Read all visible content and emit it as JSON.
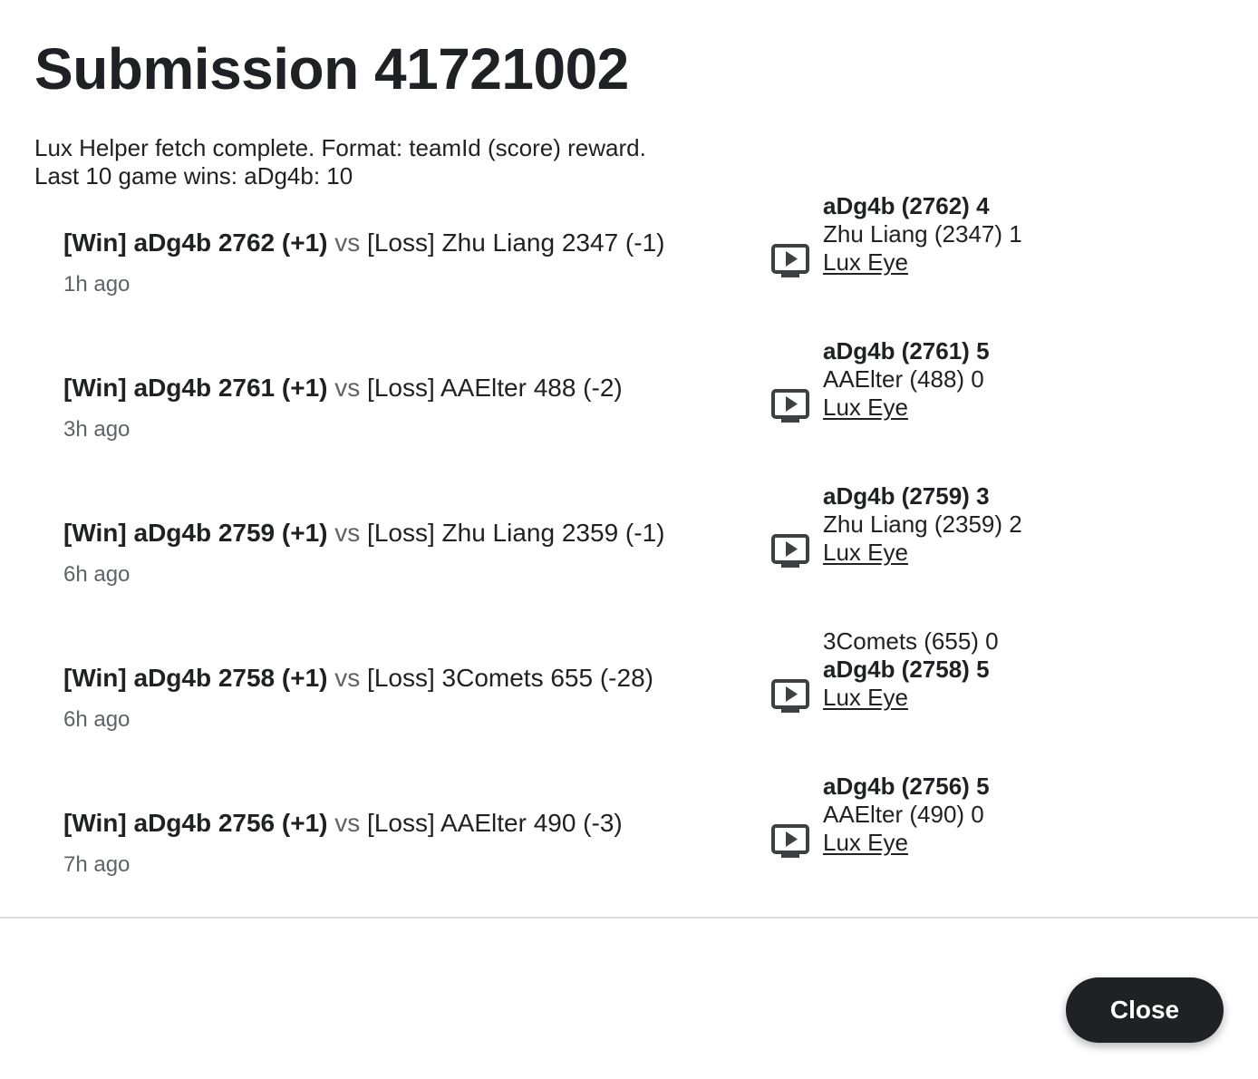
{
  "dialog": {
    "title": "Submission 41721002",
    "info_line1": "Lux Helper fetch complete. Format: teamId (score) reward.",
    "info_line2": "Last 10 game wins: aDg4b: 10",
    "close_label": "Close"
  },
  "matches": [
    {
      "win_text": "[Win] aDg4b 2762 (+1)",
      "vs": "vs",
      "loss_text": "[Loss] Zhu Liang 2347 (-1)",
      "time_ago": "1h ago",
      "team1": {
        "text": "aDg4b (2762) 4",
        "bold": true
      },
      "team2": {
        "text": "Zhu Liang (2347) 1",
        "bold": false
      },
      "link_label": "Lux Eye"
    },
    {
      "win_text": "[Win] aDg4b 2761 (+1)",
      "vs": "vs",
      "loss_text": "[Loss] AAElter 488 (-2)",
      "time_ago": "3h ago",
      "team1": {
        "text": "aDg4b (2761) 5",
        "bold": true
      },
      "team2": {
        "text": "AAElter (488) 0",
        "bold": false
      },
      "link_label": "Lux Eye"
    },
    {
      "win_text": "[Win] aDg4b 2759 (+1)",
      "vs": "vs",
      "loss_text": "[Loss] Zhu Liang 2359 (-1)",
      "time_ago": "6h ago",
      "team1": {
        "text": "aDg4b (2759) 3",
        "bold": true
      },
      "team2": {
        "text": "Zhu Liang (2359) 2",
        "bold": false
      },
      "link_label": "Lux Eye"
    },
    {
      "win_text": "[Win] aDg4b 2758 (+1)",
      "vs": "vs",
      "loss_text": "[Loss] 3Comets 655 (-28)",
      "time_ago": "6h ago",
      "team1": {
        "text": "3Comets (655) 0",
        "bold": false
      },
      "team2": {
        "text": "aDg4b (2758) 5",
        "bold": true
      },
      "link_label": "Lux Eye"
    },
    {
      "win_text": "[Win] aDg4b 2756 (+1)",
      "vs": "vs",
      "loss_text": "[Loss] AAElter 490 (-3)",
      "time_ago": "7h ago",
      "team1": {
        "text": "aDg4b (2756) 5",
        "bold": true
      },
      "team2": {
        "text": "AAElter (490) 0",
        "bold": false
      },
      "link_label": "Lux Eye"
    }
  ]
}
